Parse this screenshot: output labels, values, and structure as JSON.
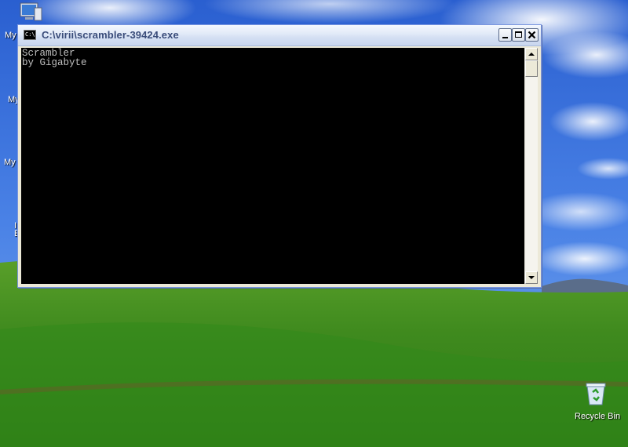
{
  "desktop": {
    "icons": [
      {
        "name": "my-computer",
        "label": "My"
      },
      {
        "name": "my-documents",
        "label": "My"
      },
      {
        "name": "my-network",
        "label": "My"
      },
      {
        "name": "internet-explorer",
        "label": "I\nE"
      },
      {
        "name": "recycle-bin",
        "label": "Recycle Bin"
      }
    ]
  },
  "window": {
    "title": "C:\\virii\\scrambler-39424.exe",
    "icon_text": "C:\\",
    "console_lines": "Scrambler\nby Gigabyte"
  },
  "colors": {
    "console_bg": "#000000",
    "console_fg": "#c0c0c0"
  }
}
